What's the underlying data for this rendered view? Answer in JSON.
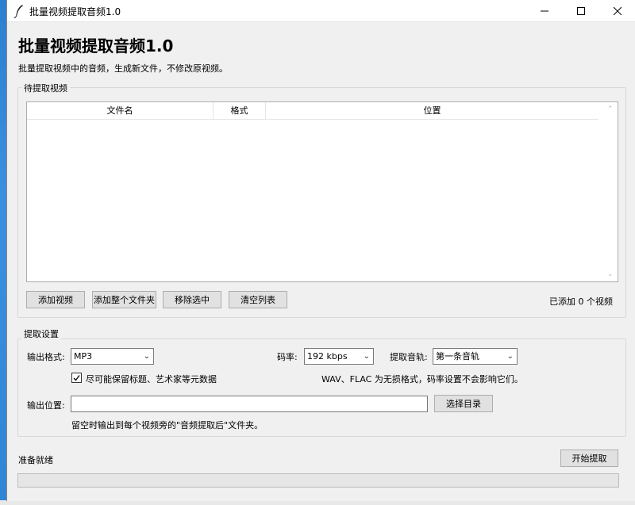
{
  "window": {
    "title": "批量视频提取音频1.0"
  },
  "header": {
    "title": "批量视频提取音频1.0",
    "subtitle": "批量提取视频中的音频，生成新文件，不修改原视频。"
  },
  "video_list": {
    "group_label": "待提取视频",
    "columns": [
      "文件名",
      "格式",
      "位置"
    ],
    "rows": [],
    "buttons": {
      "add_video": "添加视频",
      "add_folder": "添加整个文件夹",
      "remove_selected": "移除选中",
      "clear_list": "清空列表"
    },
    "count_text": "已添加 0 个视频"
  },
  "settings": {
    "group_label": "提取设置",
    "output_format_label": "输出格式:",
    "output_format_value": "MP3",
    "bitrate_label": "码率:",
    "bitrate_value": "192 kbps",
    "track_label": "提取音轨:",
    "track_value": "第一条音轨",
    "keep_metadata_checked": true,
    "keep_metadata_label": "尽可能保留标题、艺术家等元数据",
    "lossless_note": "WAV、FLAC 为无损格式，码率设置不会影响它们。",
    "output_location_label": "输出位置:",
    "output_location_value": "",
    "choose_dir_button": "选择目录",
    "output_hint": "留空时输出到每个视频旁的\"音频提取后\"文件夹。"
  },
  "footer": {
    "status": "准备就绪",
    "start_button": "开始提取",
    "progress": 0
  }
}
